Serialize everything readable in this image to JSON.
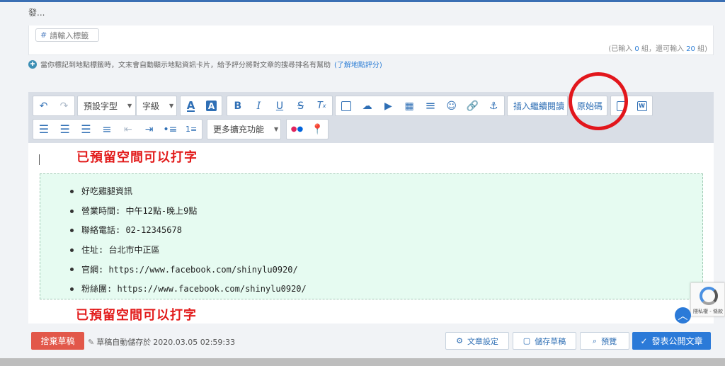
{
  "title_partial": "發...",
  "tags": {
    "placeholder": "請輸入標籤",
    "count_prefix": "(已輸入",
    "count_entered": "0",
    "count_mid": "組，還可輸入",
    "count_remaining": "20",
    "count_suffix": "組)"
  },
  "hint": {
    "text": "當你標記到地點標籤時，文末會自動顯示地點資訊卡片，給予評分將對文章的搜尋排名有幫助",
    "link": "(了解地點評分)"
  },
  "toolbar": {
    "font_select": "預設字型",
    "size_select": "字級",
    "insert_read_more": "插入繼續閱讀",
    "source_code": "原始碼",
    "more_extensions": "更多擴充功能"
  },
  "editor": {
    "note_top": "已預留空間可以打字",
    "note_bottom": "已預留空間可以打字",
    "info_items": [
      "好吃雞腿資訊",
      "營業時間: 中午12點-晚上9點",
      "聯絡電話: 02-12345678",
      "住址: 台北市中正區",
      "官網: https://www.facebook.com/shinylu0920/",
      "粉絲團: https://www.facebook.com/shinylu0920/"
    ]
  },
  "recaptcha": {
    "label": "隱私權 - 條款"
  },
  "footer": {
    "discard": "捨棄草稿",
    "autosave_prefix": "草稿自動儲存於",
    "autosave_time": "2020.03.05 02:59:33",
    "settings": "文章設定",
    "save_draft": "儲存草稿",
    "preview": "預覽",
    "publish": "發表公開文章"
  },
  "colors": {
    "accent": "#2b7ad8",
    "danger": "#e2584a",
    "annotation_red": "#e2161c"
  }
}
